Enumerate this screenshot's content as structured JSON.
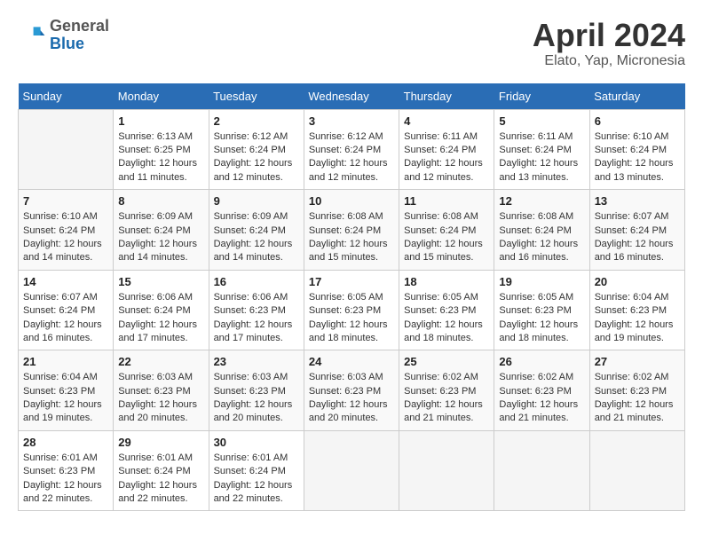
{
  "header": {
    "logo": {
      "general": "General",
      "blue": "Blue"
    },
    "title": "April 2024",
    "location": "Elato, Yap, Micronesia"
  },
  "weekdays": [
    "Sunday",
    "Monday",
    "Tuesday",
    "Wednesday",
    "Thursday",
    "Friday",
    "Saturday"
  ],
  "weeks": [
    [
      {
        "day": null,
        "info": null
      },
      {
        "day": "1",
        "info": "Sunrise: 6:13 AM\nSunset: 6:25 PM\nDaylight: 12 hours\nand 11 minutes."
      },
      {
        "day": "2",
        "info": "Sunrise: 6:12 AM\nSunset: 6:24 PM\nDaylight: 12 hours\nand 12 minutes."
      },
      {
        "day": "3",
        "info": "Sunrise: 6:12 AM\nSunset: 6:24 PM\nDaylight: 12 hours\nand 12 minutes."
      },
      {
        "day": "4",
        "info": "Sunrise: 6:11 AM\nSunset: 6:24 PM\nDaylight: 12 hours\nand 12 minutes."
      },
      {
        "day": "5",
        "info": "Sunrise: 6:11 AM\nSunset: 6:24 PM\nDaylight: 12 hours\nand 13 minutes."
      },
      {
        "day": "6",
        "info": "Sunrise: 6:10 AM\nSunset: 6:24 PM\nDaylight: 12 hours\nand 13 minutes."
      }
    ],
    [
      {
        "day": "7",
        "info": "Sunrise: 6:10 AM\nSunset: 6:24 PM\nDaylight: 12 hours\nand 14 minutes."
      },
      {
        "day": "8",
        "info": "Sunrise: 6:09 AM\nSunset: 6:24 PM\nDaylight: 12 hours\nand 14 minutes."
      },
      {
        "day": "9",
        "info": "Sunrise: 6:09 AM\nSunset: 6:24 PM\nDaylight: 12 hours\nand 14 minutes."
      },
      {
        "day": "10",
        "info": "Sunrise: 6:08 AM\nSunset: 6:24 PM\nDaylight: 12 hours\nand 15 minutes."
      },
      {
        "day": "11",
        "info": "Sunrise: 6:08 AM\nSunset: 6:24 PM\nDaylight: 12 hours\nand 15 minutes."
      },
      {
        "day": "12",
        "info": "Sunrise: 6:08 AM\nSunset: 6:24 PM\nDaylight: 12 hours\nand 16 minutes."
      },
      {
        "day": "13",
        "info": "Sunrise: 6:07 AM\nSunset: 6:24 PM\nDaylight: 12 hours\nand 16 minutes."
      }
    ],
    [
      {
        "day": "14",
        "info": "Sunrise: 6:07 AM\nSunset: 6:24 PM\nDaylight: 12 hours\nand 16 minutes."
      },
      {
        "day": "15",
        "info": "Sunrise: 6:06 AM\nSunset: 6:24 PM\nDaylight: 12 hours\nand 17 minutes."
      },
      {
        "day": "16",
        "info": "Sunrise: 6:06 AM\nSunset: 6:23 PM\nDaylight: 12 hours\nand 17 minutes."
      },
      {
        "day": "17",
        "info": "Sunrise: 6:05 AM\nSunset: 6:23 PM\nDaylight: 12 hours\nand 18 minutes."
      },
      {
        "day": "18",
        "info": "Sunrise: 6:05 AM\nSunset: 6:23 PM\nDaylight: 12 hours\nand 18 minutes."
      },
      {
        "day": "19",
        "info": "Sunrise: 6:05 AM\nSunset: 6:23 PM\nDaylight: 12 hours\nand 18 minutes."
      },
      {
        "day": "20",
        "info": "Sunrise: 6:04 AM\nSunset: 6:23 PM\nDaylight: 12 hours\nand 19 minutes."
      }
    ],
    [
      {
        "day": "21",
        "info": "Sunrise: 6:04 AM\nSunset: 6:23 PM\nDaylight: 12 hours\nand 19 minutes."
      },
      {
        "day": "22",
        "info": "Sunrise: 6:03 AM\nSunset: 6:23 PM\nDaylight: 12 hours\nand 20 minutes."
      },
      {
        "day": "23",
        "info": "Sunrise: 6:03 AM\nSunset: 6:23 PM\nDaylight: 12 hours\nand 20 minutes."
      },
      {
        "day": "24",
        "info": "Sunrise: 6:03 AM\nSunset: 6:23 PM\nDaylight: 12 hours\nand 20 minutes."
      },
      {
        "day": "25",
        "info": "Sunrise: 6:02 AM\nSunset: 6:23 PM\nDaylight: 12 hours\nand 21 minutes."
      },
      {
        "day": "26",
        "info": "Sunrise: 6:02 AM\nSunset: 6:23 PM\nDaylight: 12 hours\nand 21 minutes."
      },
      {
        "day": "27",
        "info": "Sunrise: 6:02 AM\nSunset: 6:23 PM\nDaylight: 12 hours\nand 21 minutes."
      }
    ],
    [
      {
        "day": "28",
        "info": "Sunrise: 6:01 AM\nSunset: 6:23 PM\nDaylight: 12 hours\nand 22 minutes."
      },
      {
        "day": "29",
        "info": "Sunrise: 6:01 AM\nSunset: 6:24 PM\nDaylight: 12 hours\nand 22 minutes."
      },
      {
        "day": "30",
        "info": "Sunrise: 6:01 AM\nSunset: 6:24 PM\nDaylight: 12 hours\nand 22 minutes."
      },
      {
        "day": null,
        "info": null
      },
      {
        "day": null,
        "info": null
      },
      {
        "day": null,
        "info": null
      },
      {
        "day": null,
        "info": null
      }
    ]
  ]
}
